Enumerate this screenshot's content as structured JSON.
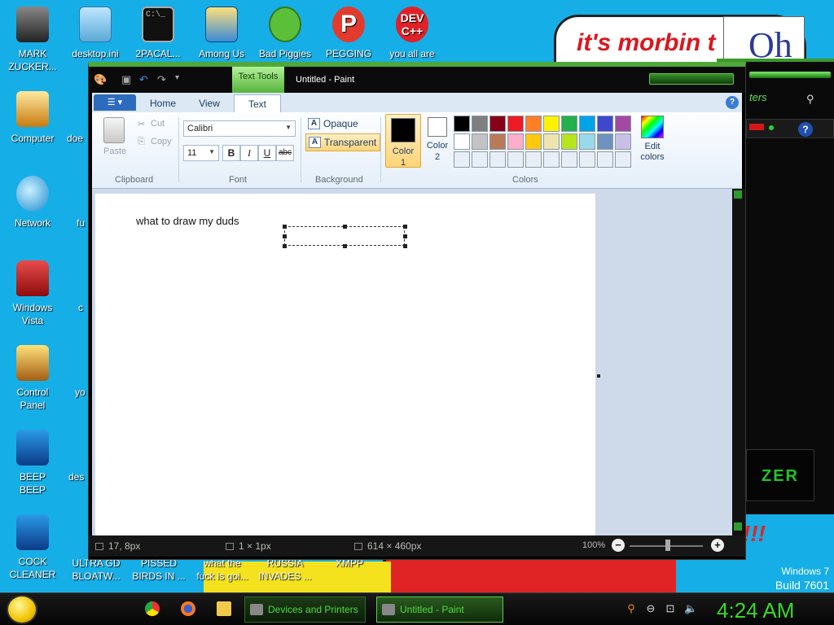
{
  "desktop": {
    "bubble_text": "it's morbin t",
    "bubble_o": "Oh",
    "exclaim": "!!!",
    "watermark_line1": "Windows 7",
    "watermark_line2": "Build 7601",
    "icons_top": [
      {
        "label": "MARK\nZUCKER...",
        "icon": "mark-zuckerberg-icon"
      },
      {
        "label": "desktop.ini",
        "icon": "ini-file-icon"
      },
      {
        "label": "2PACAL...",
        "icon": "cmd-icon"
      },
      {
        "label": "Among Us",
        "icon": "among-us-icon"
      },
      {
        "label": "Bad Piggies",
        "icon": "bad-piggies-icon"
      },
      {
        "label": "PEGGING",
        "icon": "p-logo-icon"
      },
      {
        "label": "you all are",
        "icon": "dev-cpp-icon"
      }
    ],
    "icons_left": [
      {
        "label": "Computer",
        "icon": "computer-icon"
      },
      {
        "label": "Network",
        "icon": "network-icon"
      },
      {
        "label": "Windows\nVista",
        "icon": "recycle-bin-icon"
      },
      {
        "label": "Control\nPanel",
        "icon": "control-panel-icon"
      },
      {
        "label": "BEEP\nBEEP",
        "icon": "blue-app-icon"
      },
      {
        "label": "COCK\nCLEANER",
        "icon": "blue-app-icon"
      }
    ],
    "icons_col2_partial": [
      "doe",
      "fu",
      "c",
      "yo",
      "des"
    ],
    "icons_bottom": [
      {
        "label": "ULTRA GD\nBLOATW..."
      },
      {
        "label": "PISSED\nBIRDS IN ..."
      },
      {
        "label": "what the\nfuck is goi..."
      },
      {
        "label": "RUSSIA\nINVADES ..."
      },
      {
        "label": "XMPP"
      }
    ]
  },
  "bg_window": {
    "filter_text": "ters",
    "razer_text": "ZER"
  },
  "paint": {
    "contextual_tab": "Text Tools",
    "title": "Untitled - Paint",
    "tabs": [
      "Home",
      "View",
      "Text"
    ],
    "active_tab": "Text",
    "clipboard": {
      "paste": "Paste",
      "cut": "Cut",
      "copy": "Copy",
      "group": "Clipboard"
    },
    "font": {
      "family": "Calibri",
      "size": "11",
      "bold": "B",
      "italic": "I",
      "underline": "U",
      "strike": "abc",
      "group": "Font"
    },
    "background": {
      "opaque": "Opaque",
      "transparent": "Transparent",
      "selected": "Transparent",
      "group": "Background"
    },
    "colors": {
      "color1_label": "Color\n1",
      "color2_label": "Color\n2",
      "color1": "#000000",
      "color2": "#ffffff",
      "edit_label": "Edit\ncolors",
      "group": "Colors",
      "palette": [
        "#000000",
        "#7f7f7f",
        "#880015",
        "#ed1c24",
        "#ff7f27",
        "#fff200",
        "#22b14c",
        "#00a2e8",
        "#3f48cc",
        "#a349a4",
        "#ffffff",
        "#c3c3c3",
        "#b97a57",
        "#ffaec9",
        "#ffc90e",
        "#efe4b0",
        "#b5e61d",
        "#99d9ea",
        "#7092be",
        "#c8bfe7",
        "#e8eef5",
        "#e8eef5",
        "#e8eef5",
        "#e8eef5",
        "#e8eef5",
        "#e8eef5",
        "#e8eef5",
        "#e8eef5",
        "#e8eef5",
        "#e8eef5"
      ]
    },
    "canvas_text": "what to draw my duds",
    "status": {
      "cursor": "17, 8px",
      "selection": "1 × 1px",
      "size": "614 × 460px",
      "zoom": "100%"
    }
  },
  "taskbar": {
    "tasks": [
      {
        "label": "Devices and Printers",
        "active": false
      },
      {
        "label": "Untitled - Paint",
        "active": true
      }
    ],
    "clock": "4:24 AM"
  }
}
